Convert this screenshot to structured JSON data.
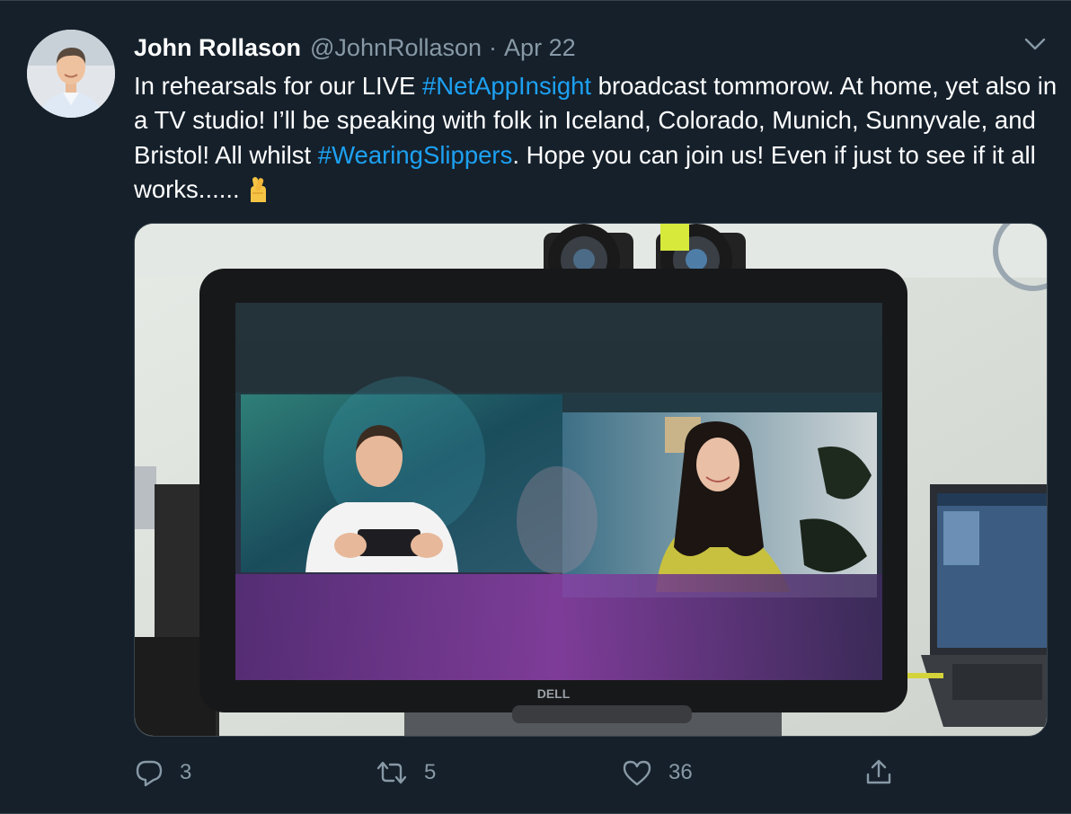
{
  "tweet": {
    "author_name": "John Rollason",
    "author_handle": "@JohnRollason",
    "separator": "·",
    "date": "Apr 22",
    "text_parts": {
      "p1": "In rehearsals for our LIVE ",
      "hashtag1": "#NetAppInsight",
      "p2": " broadcast tommorow. At home, yet also in a TV studio! I’ll be speaking with folk in Iceland, Colorado, Munich, Sunnyvale, and Bristol! All whilst ",
      "hashtag2": "#WearingSlippers",
      "p3": ". Hope you can join us! Even if just to see if it all works...... "
    },
    "emoji": "crossed-fingers-emoji",
    "media": {
      "monitor_brand": "DELL"
    },
    "actions": {
      "reply_count": "3",
      "retweet_count": "5",
      "like_count": "36"
    }
  },
  "colors": {
    "background": "#15202b",
    "text": "#ffffff",
    "secondary_text": "#8899a6",
    "hashtag": "#1da1f2",
    "border": "#38444d"
  },
  "icons": [
    "chevron-down-icon",
    "reply-icon",
    "retweet-icon",
    "like-icon",
    "share-icon"
  ]
}
